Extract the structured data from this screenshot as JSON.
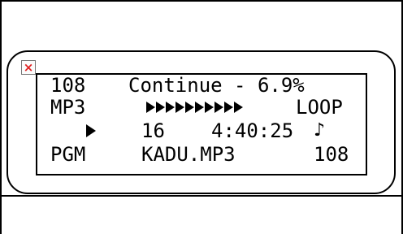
{
  "display": {
    "row1": {
      "track_number": "108",
      "mode_text": "Continue - 6.9%"
    },
    "row2": {
      "format": "MP3",
      "progress_percent": 6.9,
      "progress_segments": 10,
      "loop_label": "LOOP"
    },
    "row3": {
      "status_icon": "play-icon",
      "track_index": "16",
      "time": "4:40:25",
      "note_icon": "music-note-icon",
      "note_glyph": "♪"
    },
    "row4": {
      "program_label": "PGM",
      "filename": "KADU.MP3",
      "total": "108"
    }
  },
  "close_button": {
    "glyph": "×",
    "color": "#e02020"
  }
}
